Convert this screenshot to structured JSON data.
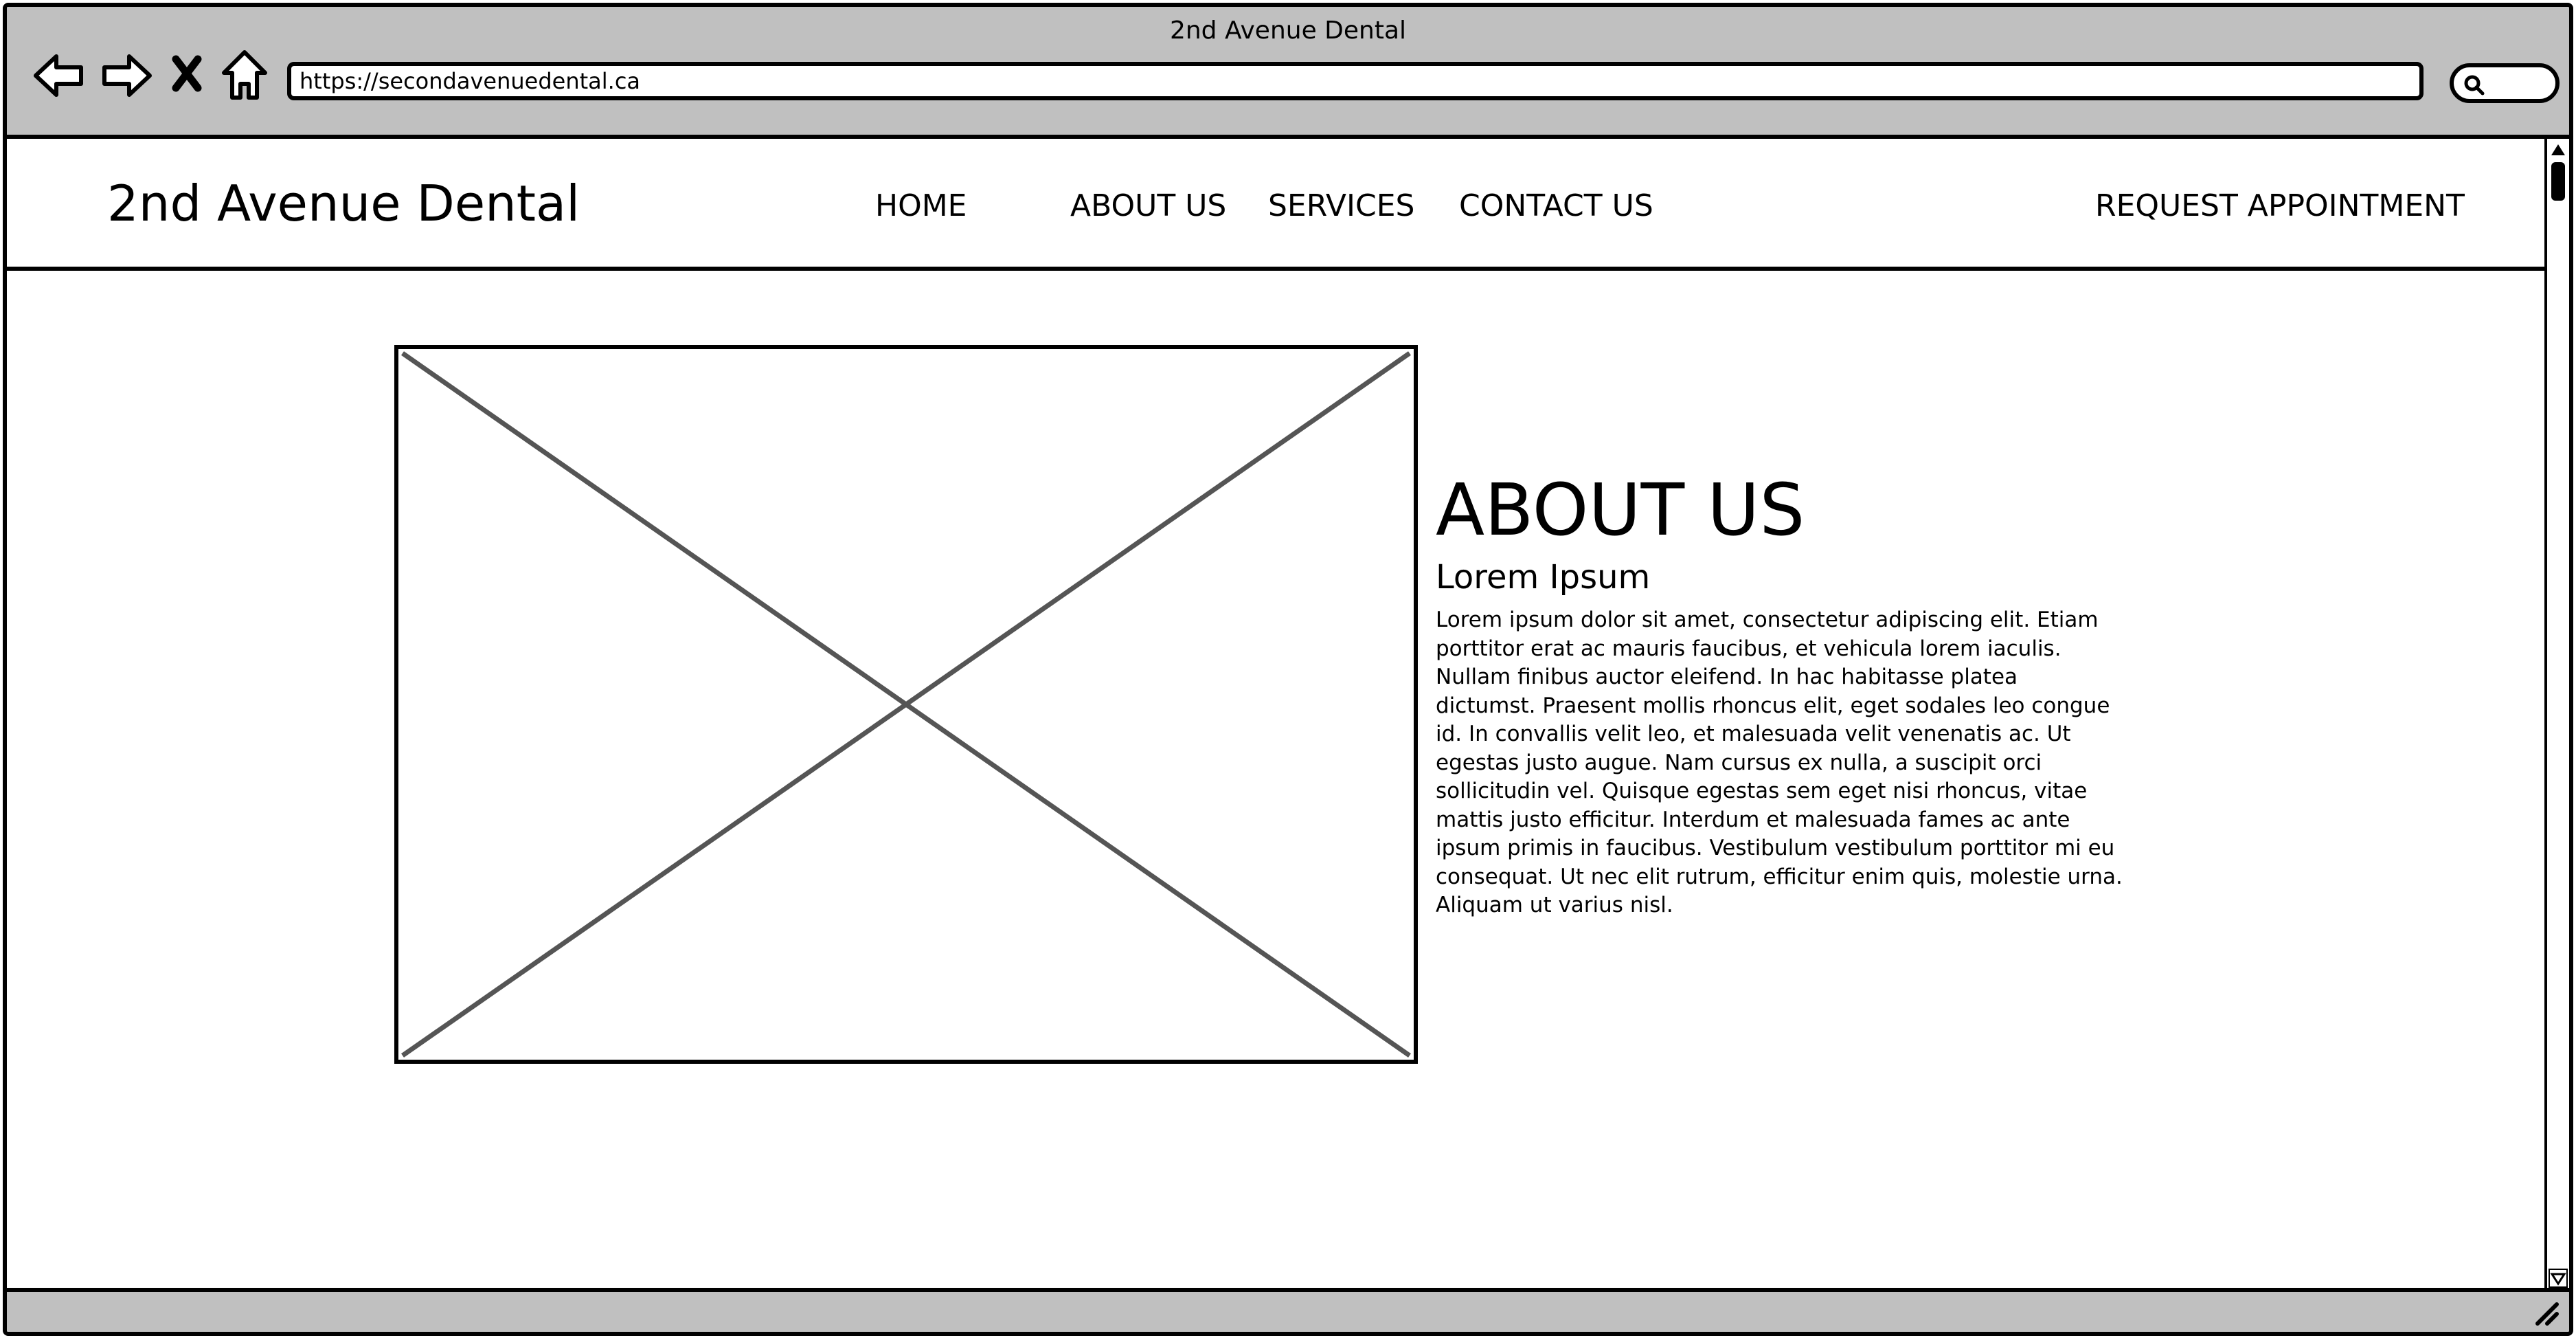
{
  "browser": {
    "window_title": "2nd Avenue Dental",
    "url": "https://secondavenuedental.ca",
    "icons": [
      "back-arrow-icon",
      "forward-arrow-icon",
      "close-x-icon",
      "home-icon",
      "search-icon",
      "resize-grip-icon"
    ]
  },
  "header": {
    "logo_text": "2nd Avenue Dental",
    "nav": {
      "home": "HOME",
      "about": "ABOUT US",
      "services": "SERVICES",
      "contact": "CONTACT US",
      "request": "REQUEST APPOINTMENT"
    }
  },
  "main": {
    "image_placeholder": "image-placeholder",
    "about": {
      "heading": "ABOUT US",
      "subheading": "Lorem Ipsum",
      "body": "Lorem ipsum dolor sit amet, consectetur adipiscing elit. Etiam porttitor erat ac mauris faucibus, et vehicula lorem iaculis. Nullam finibus auctor eleifend. In hac habitasse platea dictumst. Praesent mollis rhoncus elit, eget sodales leo congue id. In convallis velit leo, et malesuada velit venenatis ac. Ut egestas justo augue. Nam cursus ex nulla, a suscipit orci sollicitudin vel. Quisque egestas sem eget nisi rhoncus, vitae mattis justo efficitur. Interdum et malesuada fames ac ante ipsum primis in faucibus. Vestibulum vestibulum porttitor mi eu consequat. Ut nec elit rutrum, efficitur enim quis, molestie urna. Aliquam ut varius nisl."
    }
  },
  "colors": {
    "chrome": "#c0c0c0",
    "border": "#000000",
    "page_bg": "#ffffff",
    "placeholder_lines": "#555555"
  }
}
